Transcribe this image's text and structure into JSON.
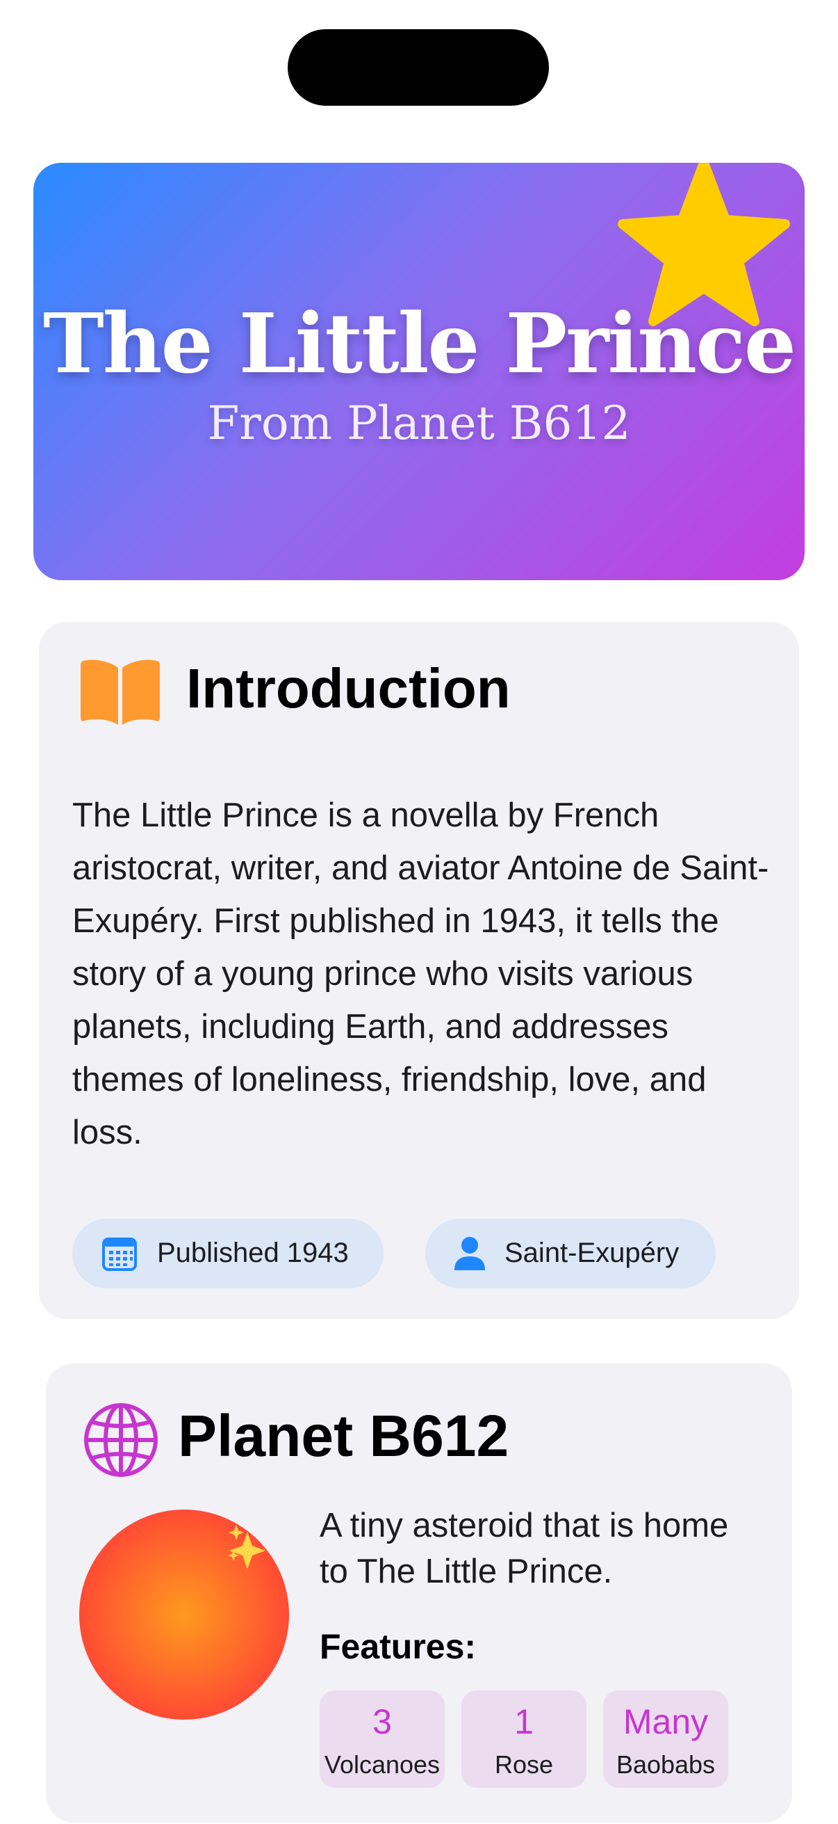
{
  "hero": {
    "title": "The Little Prince",
    "subtitle": "From Planet B612",
    "icon": "star-icon",
    "gradient": [
      "#2a8bff",
      "#c43de0"
    ],
    "star_color": "#ffcc00"
  },
  "introduction": {
    "icon": "book-icon",
    "icon_color": "#ff9a30",
    "title": "Introduction",
    "text": "The Little Prince is a novella by French aristocrat, writer, and aviator Antoine de Saint-Exupéry. First published in 1943, it tells the story of a young prince who visits various planets, including Earth, and addresses themes of loneliness, friendship, love, and loss.",
    "badges": [
      {
        "icon": "calendar-icon",
        "label": "Published 1943"
      },
      {
        "icon": "person-icon",
        "label": "Saint-Exupéry"
      }
    ]
  },
  "planet": {
    "icon": "globe-icon",
    "icon_color": "#c636cf",
    "title": "Planet B612",
    "description": "A tiny asteroid that is home to The Little Prince.",
    "features_label": "Features:",
    "features": [
      {
        "value": "3",
        "label": "Volcanoes"
      },
      {
        "value": "1",
        "label": "Rose"
      },
      {
        "value": "Many",
        "label": "Baobabs"
      }
    ]
  }
}
